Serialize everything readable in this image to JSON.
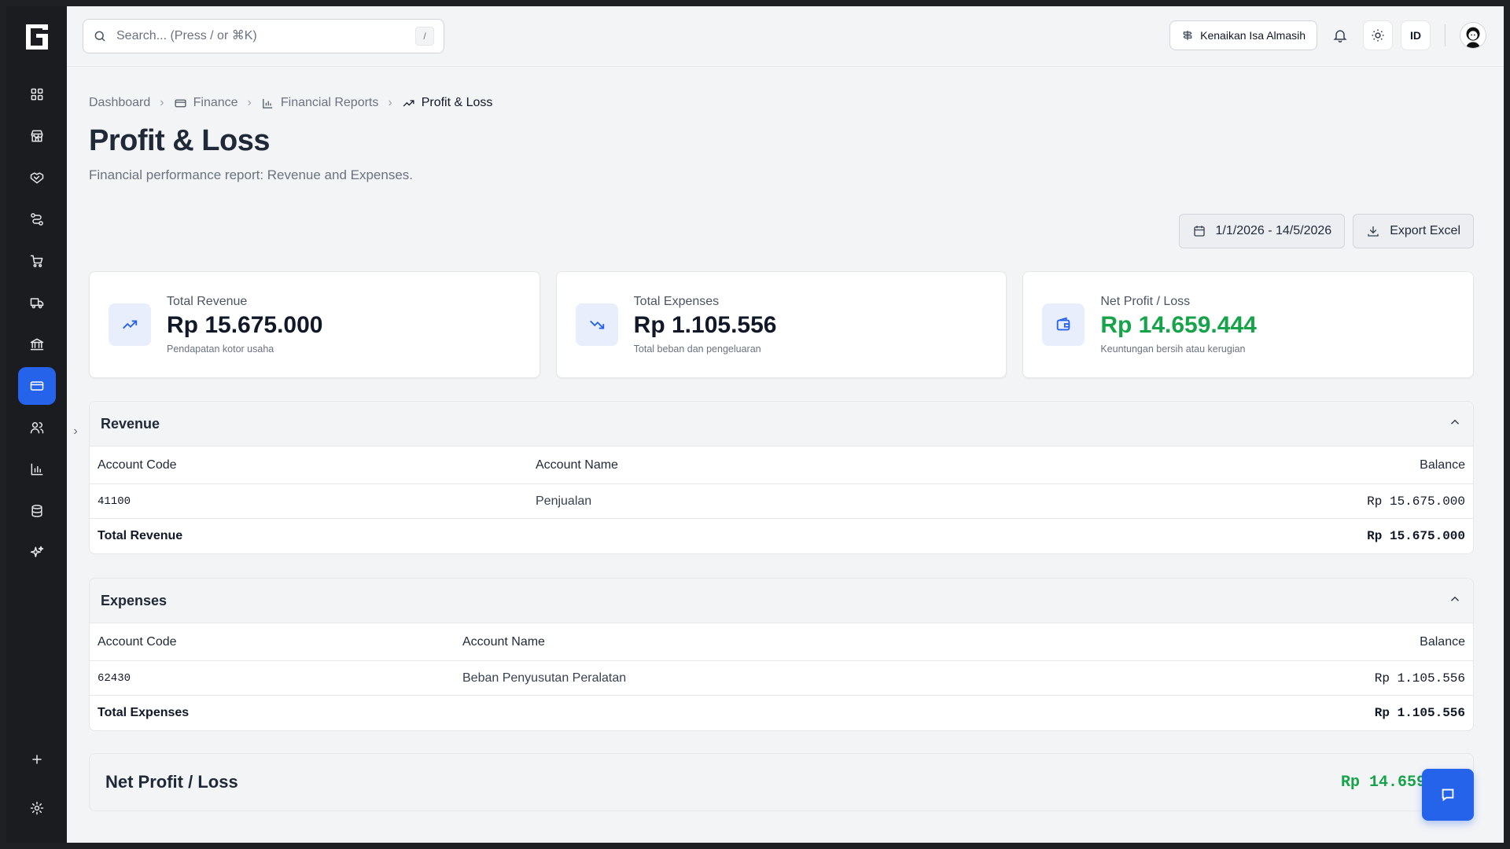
{
  "search": {
    "placeholder": "Search... (Press / or ⌘K)",
    "shortcut": "/"
  },
  "header": {
    "company": "Kenaikan Isa Almasih",
    "language": "ID"
  },
  "sidebar": {
    "items": [
      {
        "icon": "grid-icon"
      },
      {
        "icon": "store-icon"
      },
      {
        "icon": "handshake-icon"
      },
      {
        "icon": "route-icon"
      },
      {
        "icon": "cart-icon"
      },
      {
        "icon": "truck-icon"
      },
      {
        "icon": "bank-icon"
      },
      {
        "icon": "card-icon",
        "active": true
      },
      {
        "icon": "users-icon"
      },
      {
        "icon": "bar-chart-icon"
      },
      {
        "icon": "database-icon"
      },
      {
        "icon": "sparkles-icon"
      }
    ],
    "collapse_glyph": "›"
  },
  "breadcrumb": {
    "items": [
      "Dashboard",
      "Finance",
      "Financial Reports",
      "Profit & Loss"
    ],
    "separator": "›"
  },
  "page": {
    "title": "Profit & Loss",
    "subtitle": "Financial performance report: Revenue and Expenses."
  },
  "actions": {
    "date_range": "1/1/2026 - 14/5/2026",
    "export_label": "Export Excel"
  },
  "cards": [
    {
      "label": "Total Revenue",
      "value": "Rp 15.675.000",
      "desc": "Pendapatan kotor usaha"
    },
    {
      "label": "Total Expenses",
      "value": "Rp 1.105.556",
      "desc": "Total beban dan pengeluaran"
    },
    {
      "label": "Net Profit / Loss",
      "value": "Rp 14.659.444",
      "desc": "Keuntungan bersih atau kerugian"
    }
  ],
  "revenue": {
    "title": "Revenue",
    "columns": [
      "Account Code",
      "Account Name",
      "Balance"
    ],
    "rows": [
      {
        "code": "41100",
        "name": "Penjualan",
        "balance": "Rp 15.675.000"
      }
    ],
    "total_label": "Total Revenue",
    "total_value": "Rp 15.675.000"
  },
  "expenses": {
    "title": "Expenses",
    "columns": [
      "Account Code",
      "Account Name",
      "Balance"
    ],
    "rows": [
      {
        "code": "62430",
        "name": "Beban Penyusutan Peralatan",
        "balance": "Rp 1.105.556"
      }
    ],
    "total_label": "Total Expenses",
    "total_value": "Rp 1.105.556"
  },
  "net": {
    "title": "Net Profit / Loss",
    "value": "Rp 14.659"
  },
  "colors": {
    "accent": "#2563eb",
    "positive": "#16a34a",
    "sidebar": "#1b1c20"
  }
}
